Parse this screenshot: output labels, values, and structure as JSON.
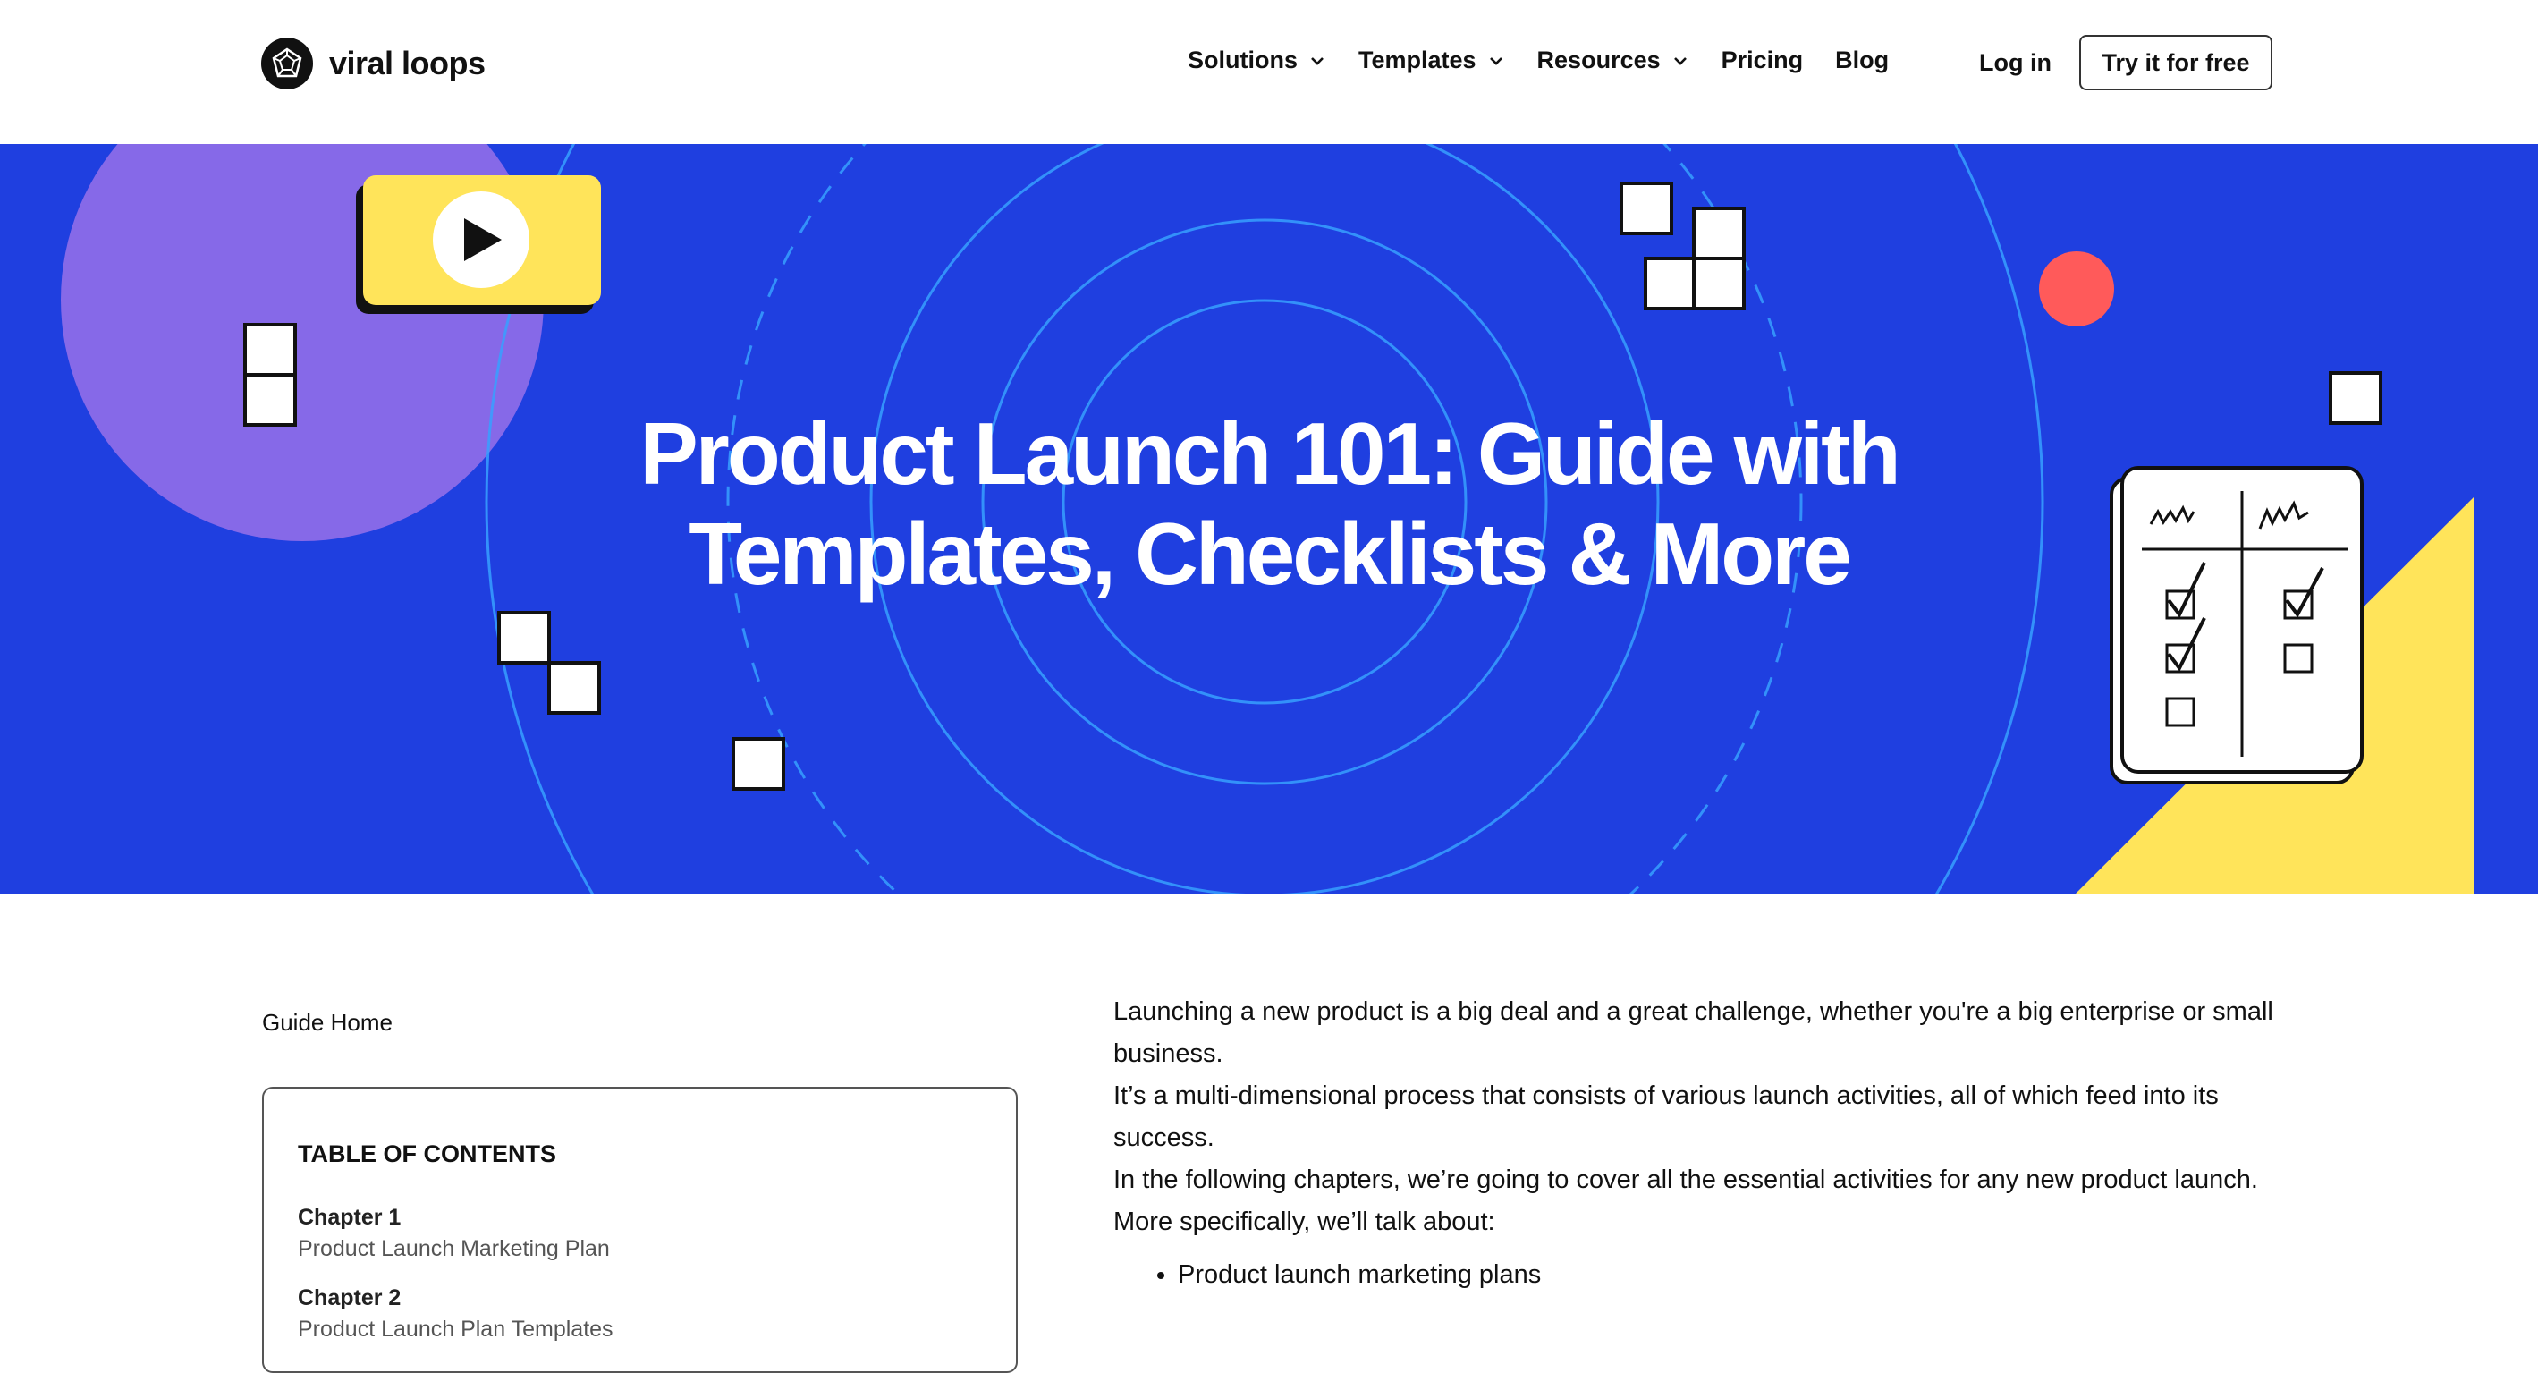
{
  "header": {
    "brand": "viral loops",
    "logo_icon": "viral-loops-logo-icon",
    "nav": [
      {
        "label": "Solutions",
        "has_dropdown": true
      },
      {
        "label": "Templates",
        "has_dropdown": true
      },
      {
        "label": "Resources",
        "has_dropdown": true
      },
      {
        "label": "Pricing",
        "has_dropdown": false
      },
      {
        "label": "Blog",
        "has_dropdown": false
      }
    ],
    "login_label": "Log in",
    "cta_label": "Try it for free"
  },
  "hero": {
    "title_line1": "Product Launch 101: Guide with",
    "title_line2": "Templates, Checklists & More",
    "background_color": "#1f3fe0",
    "accent_yellow": "#ffe45a",
    "accent_purple": "#8c6ce8",
    "accent_red": "#ff5a5a",
    "icons": [
      "play-video-icon",
      "checklist-illustration-icon"
    ]
  },
  "sidebar": {
    "guide_home": "Guide Home",
    "toc_title": "TABLE OF CONTENTS",
    "chapters": [
      {
        "number": "Chapter 1",
        "title": "Product Launch Marketing Plan"
      },
      {
        "number": "Chapter 2",
        "title": "Product Launch Plan Templates"
      }
    ]
  },
  "article": {
    "paragraphs": [
      "Launching a new product is a big deal and a great challenge, whether you're a big enterprise or small business.",
      "It’s a multi-dimensional process that consists of various launch activities, all of which feed into its success.",
      "In the following chapters, we’re going to cover all the essential activities for any new product launch.",
      "More specifically, we’ll talk about:"
    ],
    "bullets": [
      "Product launch marketing plans"
    ]
  }
}
